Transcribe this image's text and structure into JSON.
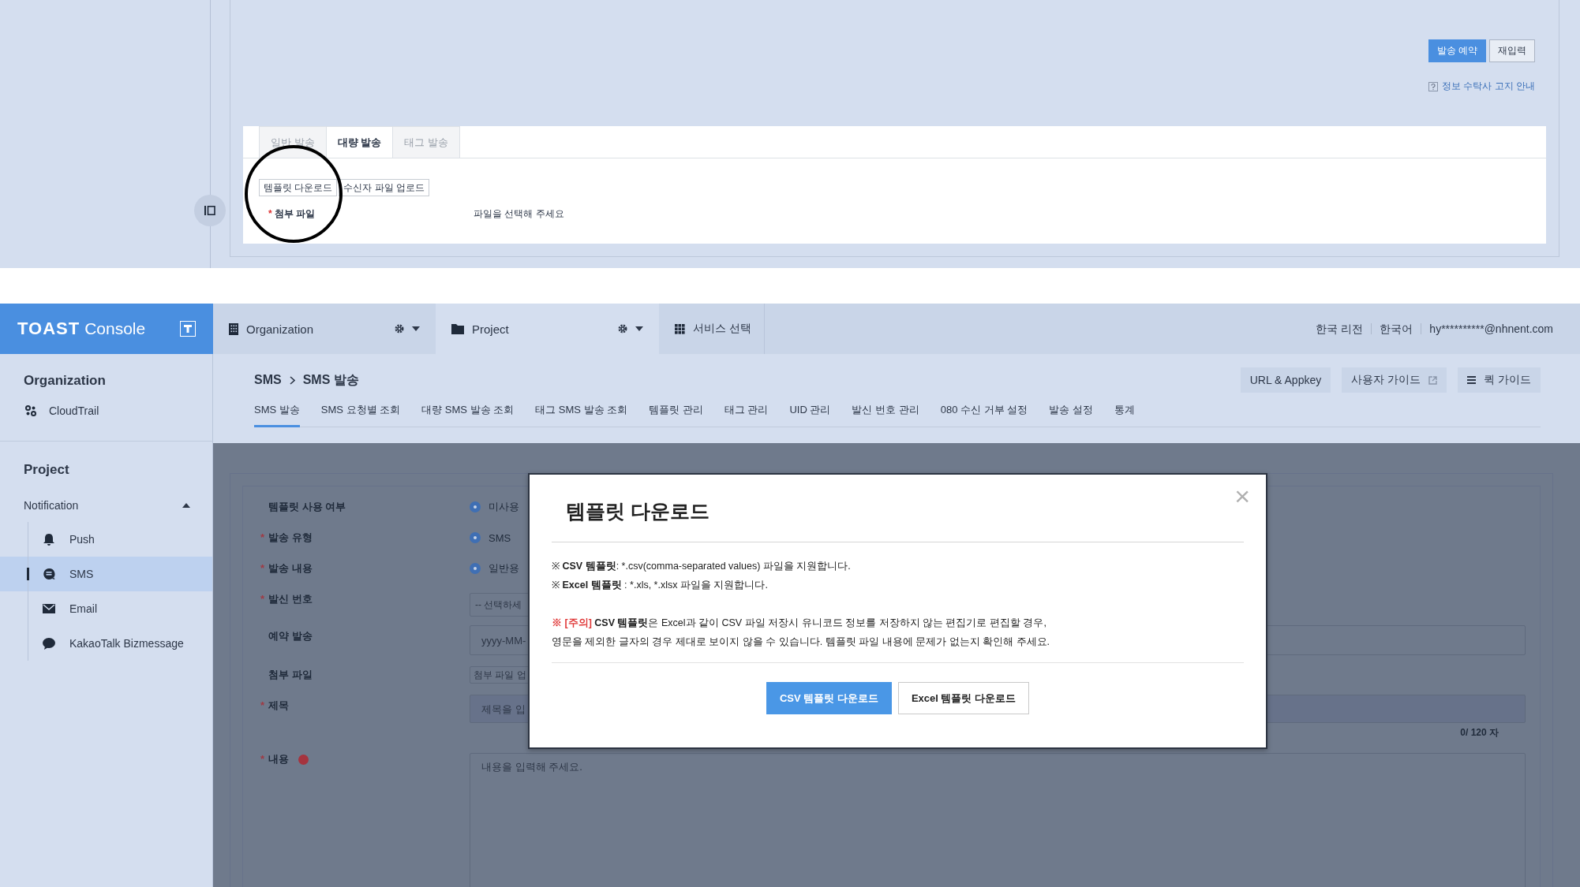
{
  "snippet": {
    "actions": [
      {
        "label": "발송 예약",
        "kind": "primary"
      },
      {
        "label": "재입력",
        "kind": "default"
      }
    ],
    "notice_link": "정보 수탁사 고지 안내",
    "tabs": [
      {
        "label": "일반 발송",
        "selected": false
      },
      {
        "label": "대량 발송",
        "selected": true
      },
      {
        "label": "태그 발송",
        "selected": false
      }
    ],
    "buttons": [
      "템플릿 다운로드",
      "수신자 파일 업로드"
    ],
    "field": {
      "label": "첨부 파일",
      "mark": "*",
      "value": "파일을 선택해 주세요"
    }
  },
  "header": {
    "logo": "TOAST",
    "logo_suffix": "Console",
    "organization": "Organization",
    "project": "Project",
    "service": "서비스 선택",
    "links": [
      "한국 리전",
      "한국어",
      "hy**********@nhnent.com"
    ]
  },
  "sidebar": {
    "organization": {
      "title": "Organization",
      "items": [
        {
          "label": "CloudTrail"
        }
      ]
    },
    "project": {
      "title": "Project",
      "group": {
        "label": "Notification",
        "expanded": true,
        "children": [
          {
            "label": "Push",
            "selected": false
          },
          {
            "label": "SMS",
            "selected": true
          },
          {
            "label": "Email",
            "selected": false
          },
          {
            "label": "KakaoTalk Bizmessage",
            "selected": false
          }
        ]
      }
    }
  },
  "main": {
    "breadcrumb": [
      "SMS",
      "SMS 발송"
    ],
    "tools": [
      {
        "label": "URL & Appkey",
        "kind": "plain"
      },
      {
        "label": "사용자 가이드",
        "kind": "external"
      },
      {
        "label": "퀵 가이드",
        "kind": "menu"
      }
    ],
    "tabs": [
      {
        "label": "SMS 발송",
        "selected": true
      },
      {
        "label": "SMS 요청별 조회",
        "selected": false
      },
      {
        "label": "대량 SMS 발송 조회",
        "selected": false
      },
      {
        "label": "태그 SMS 발송 조회",
        "selected": false
      },
      {
        "label": "템플릿 관리",
        "selected": false
      },
      {
        "label": "태그 관리",
        "selected": false
      },
      {
        "label": "UID 관리",
        "selected": false
      },
      {
        "label": "발신 번호 관리",
        "selected": false
      },
      {
        "label": "080 수신 거부 설정",
        "selected": false
      },
      {
        "label": "발송 설정",
        "selected": false
      },
      {
        "label": "통계",
        "selected": false
      }
    ]
  },
  "form": {
    "rows": [
      {
        "label": "템플릿 사용 여부",
        "kind": "radio",
        "option": "미사용",
        "selected": true
      },
      {
        "label": "발송 유형",
        "mark": "*",
        "kind": "radio",
        "option": "SMS",
        "selected": true
      },
      {
        "label": "발송 내용",
        "mark": "*",
        "kind": "radio",
        "option": "일반용",
        "selected": true
      },
      {
        "label": "발신 번호",
        "mark": "*",
        "kind": "select",
        "placeholder": "-- 선택하세"
      },
      {
        "label": "예약 발송",
        "kind": "input",
        "placeholder": "yyyy-MM-"
      },
      {
        "label": "첨부 파일",
        "kind": "file",
        "placeholder": "첨부 파일 업"
      },
      {
        "label": "제목",
        "mark": "*",
        "kind": "input",
        "placeholder": "제목을 입",
        "counter": "0/ 120 자"
      },
      {
        "label": "내용",
        "mark": "*",
        "kind": "textarea",
        "placeholder": "내용을 입력해 주세요.",
        "info": true
      }
    ]
  },
  "modal": {
    "title": "템플릿 다운로드",
    "close": "×",
    "notes": [
      {
        "lead": "※ ",
        "term": "CSV 템플릿",
        "text": ": *.csv(comma-separated values) 파일을 지원합니다."
      },
      {
        "lead": "※ ",
        "term": "Excel 템플릿",
        "text": " : *.xls, *.xlsx 파일을 지원합니다."
      }
    ],
    "warnings": [
      {
        "alert": "※ [주의]",
        "term": " CSV 템플릿",
        "text": "은 Excel과 같이 CSV 파일 저장시 유니코드 정보를 저장하지 않는 편집기로 편집할 경우,"
      },
      {
        "text": "영문을 제외한 글자의 경우 제대로 보이지 않을 수 있습니다. 템플릿 파일 내용에 문제가 없는지 확인해 주세요."
      }
    ],
    "buttons": [
      {
        "label": "CSV 템플릿 다운로드",
        "kind": "primary"
      },
      {
        "label": "Excel 템플릿 다운로드",
        "kind": "default"
      }
    ]
  }
}
